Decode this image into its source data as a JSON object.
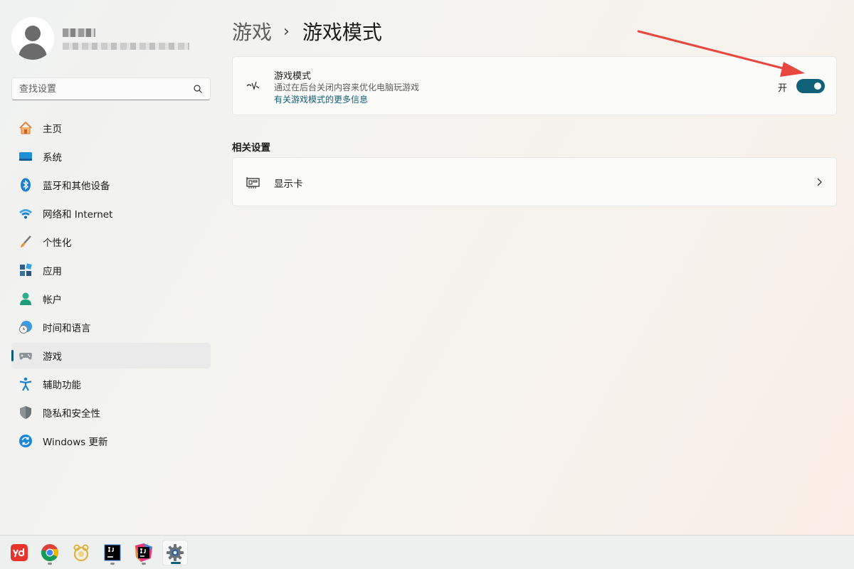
{
  "sidebar": {
    "profile": {
      "name": "",
      "email": ""
    },
    "search": {
      "placeholder": "查找设置"
    },
    "items": [
      {
        "label": "主页",
        "icon": "home-icon"
      },
      {
        "label": "系统",
        "icon": "system-icon"
      },
      {
        "label": "蓝牙和其他设备",
        "icon": "bluetooth-icon"
      },
      {
        "label": "网络和 Internet",
        "icon": "wifi-icon"
      },
      {
        "label": "个性化",
        "icon": "brush-icon"
      },
      {
        "label": "应用",
        "icon": "apps-icon"
      },
      {
        "label": "帐户",
        "icon": "account-icon"
      },
      {
        "label": "时间和语言",
        "icon": "time-language-icon"
      },
      {
        "label": "游戏",
        "icon": "gamepad-icon",
        "active": true
      },
      {
        "label": "辅助功能",
        "icon": "accessibility-icon"
      },
      {
        "label": "隐私和安全性",
        "icon": "shield-icon"
      },
      {
        "label": "Windows 更新",
        "icon": "update-icon"
      }
    ]
  },
  "main": {
    "breadcrumb": {
      "parent": "游戏",
      "separator": "›",
      "current": "游戏模式"
    },
    "game_mode": {
      "title": "游戏模式",
      "description": "通过在后台关闭内容来优化电脑玩游戏",
      "link": "有关游戏模式的更多信息",
      "toggle_label": "开",
      "toggle_on": true
    },
    "related": {
      "heading": "相关设置",
      "items": [
        {
          "label": "显示卡",
          "icon": "graphics-card-icon"
        }
      ]
    }
  },
  "annotation": {
    "color": "#e8473f"
  },
  "taskbar": {
    "apps": [
      {
        "name": "youdao-dictionary",
        "icon": "youdao-icon"
      },
      {
        "name": "google-chrome",
        "icon": "chrome-icon"
      },
      {
        "name": "navicat",
        "icon": "navicat-icon"
      },
      {
        "name": "jetbrains-ide",
        "icon": "intellij-icon"
      },
      {
        "name": "intellij-idea",
        "icon": "idea-icon"
      },
      {
        "name": "settings",
        "icon": "settings-gear-icon",
        "active": true
      }
    ]
  },
  "colors": {
    "accent": "#0f5e77",
    "toggle_on": "#0f6079"
  }
}
